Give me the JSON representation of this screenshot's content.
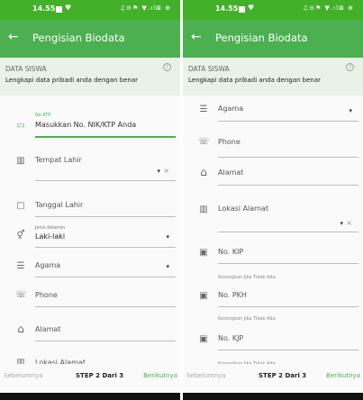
{
  "status": {
    "time": "14.55",
    "heart": "♥",
    "system_icons": "♫⊝⚑ ▼.ıl⊠ ⊕"
  },
  "appbar": {
    "back": "←",
    "title": "Pengisian Biodata"
  },
  "section": {
    "label": "DATA SISWA",
    "help": "?",
    "desc": "Lengkapi data pribadi anda dengan benar"
  },
  "left": {
    "ktp": {
      "small": "No KTP",
      "value": "Masukkan No. NIK/KTP Anda"
    },
    "tempat": {
      "label": "Tempat Lahir",
      "drop": "▾",
      "clear": "×"
    },
    "tanggal": {
      "label": "Tanggal Lahir"
    },
    "jk": {
      "small": "Jenis Kelamin",
      "value": "Laki-laki",
      "drop": "▾"
    },
    "agama": {
      "label": "Agama",
      "drop": "▾"
    },
    "phone": {
      "label": "Phone"
    },
    "alamat": {
      "label": "Alamat"
    },
    "lokasi": {
      "label": "Lokasi Alamat"
    }
  },
  "right": {
    "agama": {
      "label": "Agama",
      "drop": "▾"
    },
    "phone": {
      "label": "Phone"
    },
    "alamat": {
      "label": "Alamat"
    },
    "lokasi": {
      "label": "Lokasi Alamat",
      "drop": "▾",
      "clear": "×"
    },
    "kip": {
      "label": "No. KIP",
      "hint": "Kosongkan Jika Tidak Ada"
    },
    "pkh": {
      "label": "No. PKH",
      "hint": "Kosongkan Jika Tidak Ada"
    },
    "kjp": {
      "label": "No. KJP",
      "hint": "Kosongkan Jika Tidak Ada"
    }
  },
  "footer": {
    "prev": "Sebelumnya",
    "step": "STEP 2 Dari 3",
    "next": "Berikutnya"
  },
  "icons": {
    "card": "▭",
    "map": "▥",
    "calendar": "▢",
    "gender": "⚥",
    "list": "☰",
    "phone": "☏",
    "home": "⌂",
    "card2": "▣"
  },
  "colors": {
    "primary": "#4caf50",
    "statusbar": "#43b02a",
    "section_bg": "#e9f2e6"
  }
}
